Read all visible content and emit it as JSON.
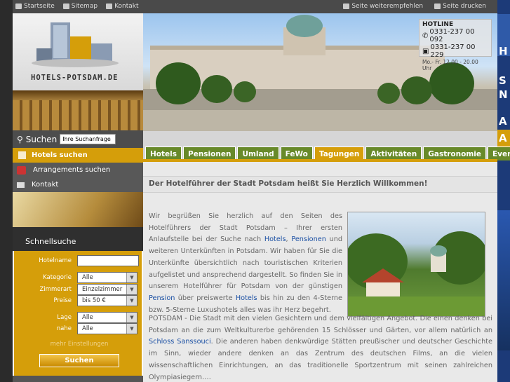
{
  "topbar": {
    "home": "Startseite",
    "sitemap": "Sitemap",
    "kontakt": "Kontakt",
    "recommend": "Seite weiterempfehlen",
    "print": "Seite drucken"
  },
  "logo": {
    "brand": "HOTELS-POTSDAM.DE"
  },
  "search": {
    "label": "Suchen",
    "placeholder": "Ihre Suchanfrage"
  },
  "leftnav": {
    "hotels": "Hotels suchen",
    "arrangements": "Arrangements suchen",
    "kontakt": "Kontakt"
  },
  "hotline": {
    "title": "HOTLINE",
    "phone": "0331-237 00 092",
    "fax": "0331-237 00 229",
    "hours": "Mo.- Fr. 12.00 - 20.00 Uhr"
  },
  "tabs": [
    "Hotels",
    "Pensionen",
    "Umland",
    "FeWo",
    "Tagungen",
    "Aktivitäten",
    "Gastronomie",
    "Events"
  ],
  "active_tab": "Tagungen",
  "quicksearch": {
    "title": "Schnellsuche",
    "hotelname_label": "Hotelname",
    "hotelname_value": "",
    "kategorie_label": "Kategorie",
    "kategorie_value": "Alle",
    "zimmerart_label": "Zimmerart",
    "zimmerart_value": "Einzelzimmer",
    "preise_label": "Preise",
    "preise_value": "bis 50 €",
    "lage_label": "Lage",
    "lage_value": "Alle",
    "nahe_label": "nahe",
    "nahe_value": "Alle",
    "more": "mehr Einstellungen",
    "submit": "Suchen"
  },
  "content": {
    "welcome": "Der Hotelführer der Stadt Potsdam heißt Sie Herzlich Willkommen!",
    "p1_a": "Wir begrüßen Sie herzlich auf den Seiten des Hotelführers der Stadt Potsdam – Ihrer ersten Anlaufstelle bei der Suche nach ",
    "p1_link1": "Hotels",
    "p1_sep": ", ",
    "p1_link2": "Pensionen",
    "p1_b": " und weiteren Unterkünften in Potsdam. Wir haben für Sie die Unterkünfte übersichtlich nach touristischen Kriterien aufgelistet und ansprechend dargestellt. So finden Sie in unserem Hotelführer für Potsdam von der günstigen ",
    "p1_link3": "Pension",
    "p1_c": " über preiswerte ",
    "p1_link4": "Hotels",
    "p1_d": " bis hin zu den 4-Sterne bzw. 5-Sterne Luxushotels alles was ihr Herz begehrt.",
    "p2_a": "POTSDAM - Die Stadt mit den vielen Gesichtern und dem vielfältigen Angebot. Die einen denken bei Potsdam an die zum Weltkulturerbe gehörenden 15 Schlösser und Gärten, vor allem natürlich an ",
    "p2_link": "Schloss Sanssouci",
    "p2_b": ". Die anderen haben denkwürdige Stätten preußischer und deutscher Geschichte im Sinn, wieder andere denken an das Zentrum des deutschen Films, an die vielen wissenschaftlichen Einrichtungen, an das traditionelle Sportzentrum mit seinen zahlreichen Olympiasiegern…."
  },
  "colors": {
    "accent": "#d59e0a",
    "tab_green": "#688a2a",
    "link": "#1a4fa3",
    "dark": "#4d4d4d"
  },
  "right_banner": {
    "glyphs": [
      "H",
      "S",
      "N",
      "A",
      "A"
    ]
  }
}
